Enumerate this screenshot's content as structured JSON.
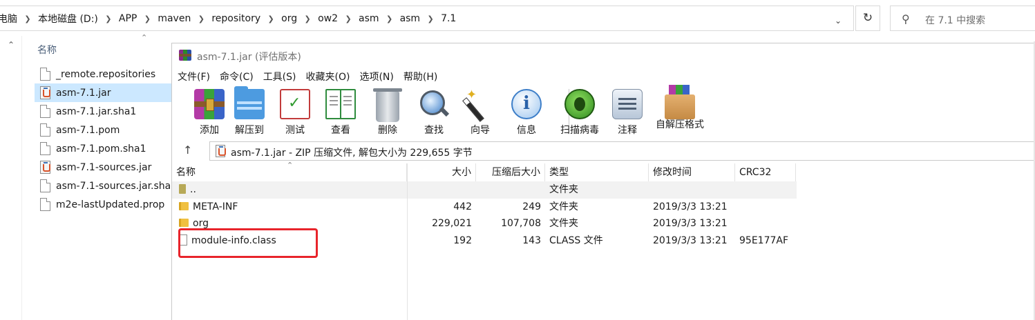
{
  "explorer": {
    "breadcrumbs": [
      "电脑",
      "本地磁盘 (D:)",
      "APP",
      "maven",
      "repository",
      "org",
      "ow2",
      "asm",
      "asm",
      "7.1"
    ],
    "search_placeholder": "在 7.1 中搜索",
    "column_name": "名称",
    "files": [
      {
        "name": "_remote.repositories",
        "icon": "doc-icon"
      },
      {
        "name": "asm-7.1.jar",
        "icon": "jar-icon",
        "selected": true
      },
      {
        "name": "asm-7.1.jar.sha1",
        "icon": "doc-icon"
      },
      {
        "name": "asm-7.1.pom",
        "icon": "doc-icon"
      },
      {
        "name": "asm-7.1.pom.sha1",
        "icon": "doc-icon"
      },
      {
        "name": "asm-7.1-sources.jar",
        "icon": "jar-icon"
      },
      {
        "name": "asm-7.1-sources.jar.sha",
        "icon": "doc-icon"
      },
      {
        "name": "m2e-lastUpdated.prop",
        "icon": "doc-icon"
      }
    ]
  },
  "winrar": {
    "title": "asm-7.1.jar (评估版本)",
    "menu": [
      "文件(F)",
      "命令(C)",
      "工具(S)",
      "收藏夹(O)",
      "选项(N)",
      "帮助(H)"
    ],
    "toolbar": [
      {
        "label": "添加",
        "icon": "add-archive-icon"
      },
      {
        "label": "解压到",
        "icon": "extract-folder-icon"
      },
      {
        "label": "测试",
        "icon": "test-clipboard-icon"
      },
      {
        "label": "查看",
        "icon": "view-book-icon"
      },
      {
        "label": "删除",
        "icon": "trash-icon"
      },
      {
        "label": "查找",
        "icon": "magnifier-icon"
      },
      {
        "label": "向导",
        "icon": "wizard-wand-icon"
      },
      {
        "label": "信息",
        "icon": "info-icon"
      },
      {
        "label": "扫描病毒",
        "icon": "virus-scan-icon"
      },
      {
        "label": "注释",
        "icon": "comment-icon"
      },
      {
        "label": "自解压格式",
        "icon": "sfx-box-icon"
      }
    ],
    "path": "asm-7.1.jar - ZIP 压缩文件, 解包大小为 229,655 字节",
    "columns": {
      "name": "名称",
      "size": "大小",
      "packed": "压缩后大小",
      "type": "类型",
      "modified": "修改时间",
      "crc": "CRC32"
    },
    "rows": [
      {
        "name": "..",
        "size": "",
        "packed": "",
        "type": "文件夹",
        "modified": "",
        "crc": ""
      },
      {
        "name": "META-INF",
        "size": "442",
        "packed": "249",
        "type": "文件夹",
        "modified": "2019/3/3 13:21",
        "crc": ""
      },
      {
        "name": "org",
        "size": "229,021",
        "packed": "107,708",
        "type": "文件夹",
        "modified": "2019/3/3 13:21",
        "crc": ""
      },
      {
        "name": "module-info.class",
        "size": "192",
        "packed": "143",
        "type": "CLASS 文件",
        "modified": "2019/3/3 13:21",
        "crc": "95E177AF"
      }
    ]
  },
  "highlight_color": "#e8242b"
}
